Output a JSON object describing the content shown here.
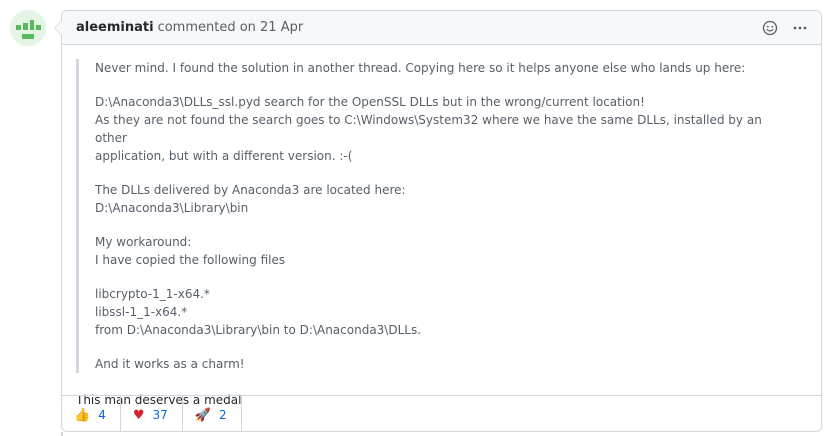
{
  "comment": {
    "author": "aleeminati",
    "meta": "commented on 21 Apr",
    "quote": {
      "paragraphs": [
        [
          "Never mind. I found the solution in another thread. Copying here so it helps anyone else who lands up here:"
        ],
        [
          "D:\\Anaconda3\\DLLs_ssl.pyd search for the OpenSSL DLLs but in the wrong/current location!",
          "As they are not found the search goes to C:\\Windows\\System32 where we have the same DLLs, installed by an other",
          "application, but with a different version. :-("
        ],
        [
          "The DLLs delivered by Anaconda3 are located here:",
          "D:\\Anaconda3\\Library\\bin"
        ],
        [
          "My workaround:",
          "I have copied the following files"
        ],
        [
          "libcrypto-1_1-x64.*",
          "libssl-1_1-x64.*",
          "from D:\\Anaconda3\\Library\\bin to D:\\Anaconda3\\DLLs."
        ],
        [
          "And it works as a charm!"
        ]
      ]
    },
    "message": "This man deserves a medal",
    "icons": {
      "emoji": "smiley-icon",
      "more": "kebab-horizontal-icon"
    },
    "reactions": [
      {
        "emoji": "👍",
        "icon": "thumbs-up-icon",
        "count": "4"
      },
      {
        "emoji": "♥",
        "icon": "heart-icon",
        "count": "37",
        "color": "#d1242f"
      },
      {
        "emoji": "🚀",
        "icon": "rocket-icon",
        "count": "2"
      }
    ]
  }
}
